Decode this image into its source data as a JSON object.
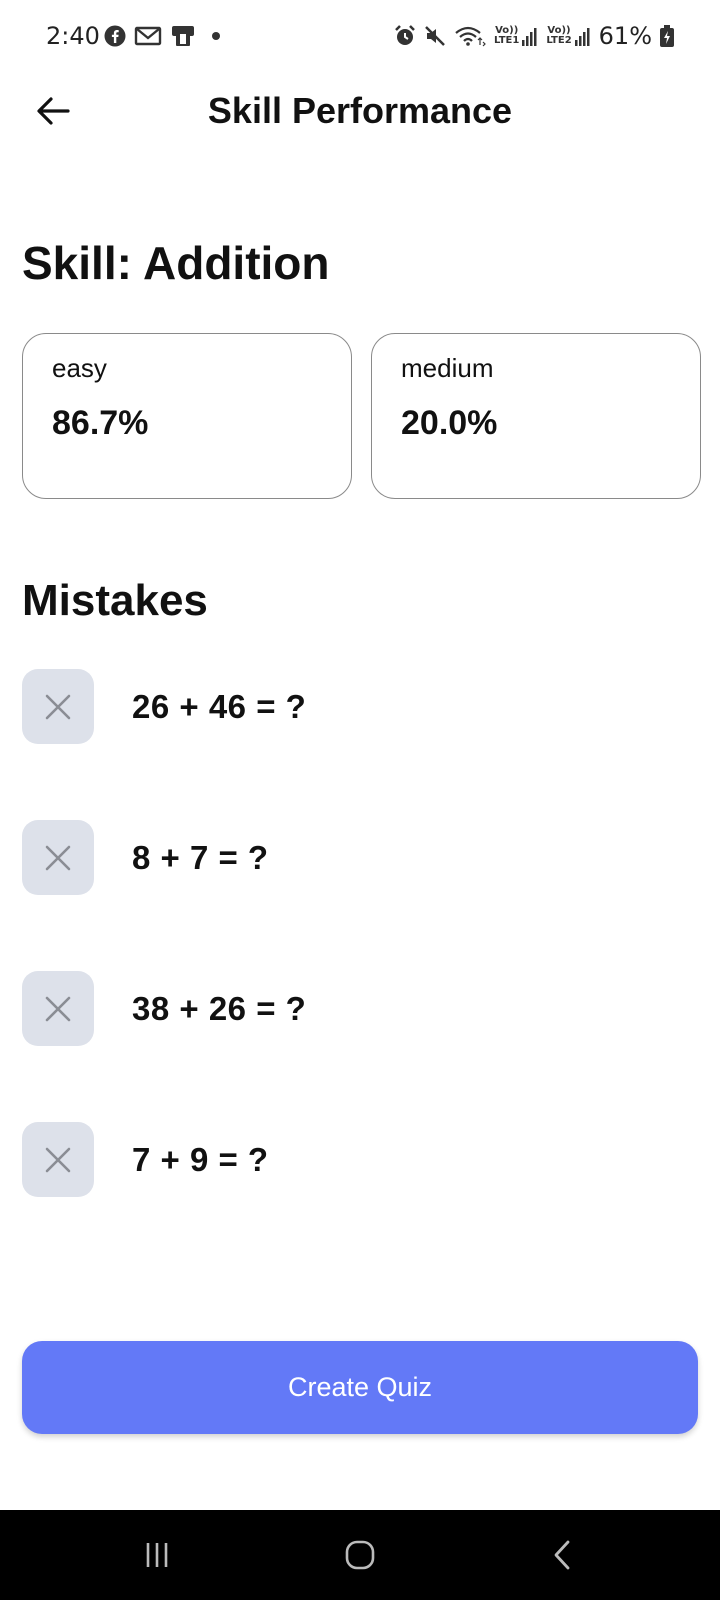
{
  "status_bar": {
    "time": "2:40",
    "battery": "61%",
    "sim1": "LTE1",
    "sim2": "LTE2",
    "volte": "Vo))",
    "icons": [
      "facebook-icon",
      "gmail-icon",
      "notification-icon",
      "alarm-icon",
      "mute-icon",
      "wifi-icon",
      "signal-icon",
      "battery-icon"
    ]
  },
  "app_bar": {
    "title": "Skill Performance",
    "back_icon": "arrow-left-icon"
  },
  "skill": {
    "heading": "Skill: Addition"
  },
  "cards": [
    {
      "label": "easy",
      "value": "86.7%"
    },
    {
      "label": "medium",
      "value": "20.0%"
    }
  ],
  "mistakes": {
    "heading": "Mistakes",
    "items": [
      {
        "text": "26 + 46 = ?",
        "icon": "close-icon"
      },
      {
        "text": "8 + 7 = ?",
        "icon": "close-icon"
      },
      {
        "text": "38 + 26 = ?",
        "icon": "close-icon"
      },
      {
        "text": "7 + 9 = ?",
        "icon": "close-icon"
      }
    ]
  },
  "actions": {
    "create_quiz": "Create Quiz"
  },
  "nav_bar": {
    "buttons": [
      "recent-apps-icon",
      "home-icon",
      "back-icon"
    ]
  },
  "colors": {
    "accent": "#6379f7",
    "icon_box": "#dde1ea",
    "card_border": "#8a8a8a"
  }
}
